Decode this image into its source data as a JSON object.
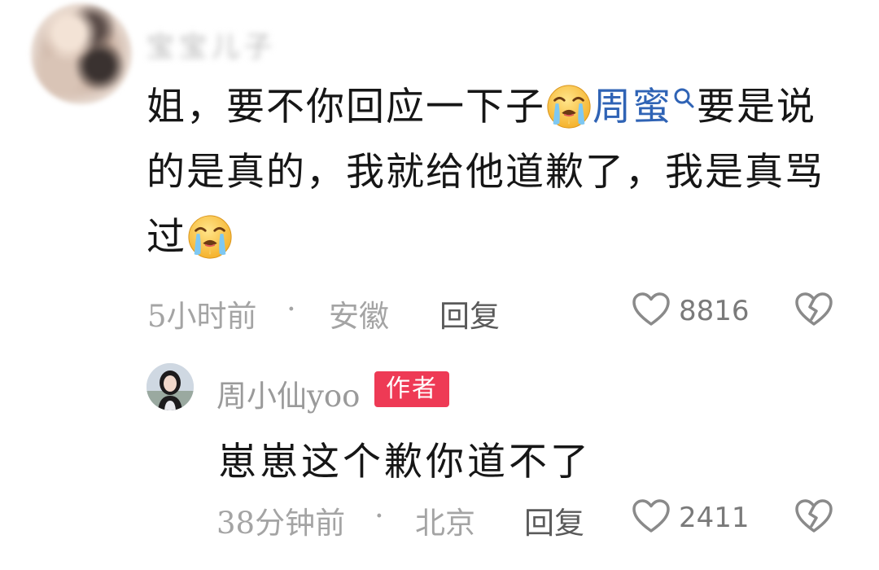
{
  "comment": {
    "username": "宝宝儿子",
    "text_1": "姐，要不你回应一下子",
    "mention": "周蜜",
    "text_2": "要是说的是真的，我就给他道歉了，我是真骂过",
    "time": "5小时前",
    "separator": "·",
    "location": "安徽",
    "reply_label": "回复",
    "likes": "8816",
    "emoji_icon": "crying-face-icon",
    "mention_icon": "search-icon"
  },
  "reply": {
    "username": "周小仙yoo",
    "badge": "作者",
    "text": "崽崽这个歉你道不了",
    "time": "38分钟前",
    "separator": "·",
    "location": "北京",
    "reply_label": "回复",
    "likes": "2411"
  },
  "colors": {
    "mention": "#2f63b5",
    "badge_bg": "#ee3a55",
    "meta_text": "#a4a4a4",
    "icon_stroke": "#8a8a8a"
  }
}
